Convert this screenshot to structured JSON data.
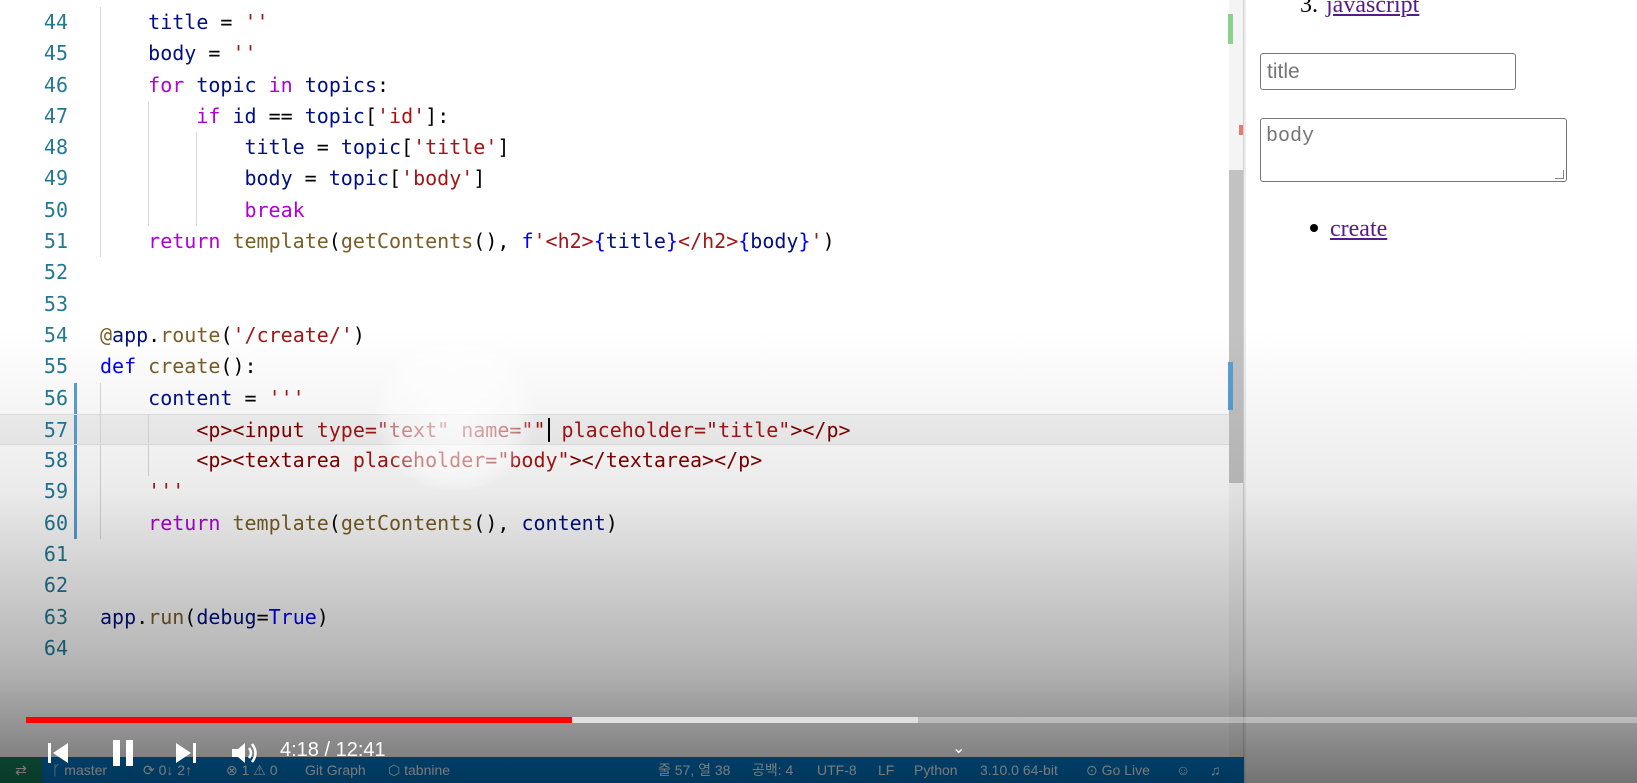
{
  "editor": {
    "lines": [
      {
        "n": "44",
        "indent": 1,
        "tokens": [
          [
            "id",
            "title"
          ],
          [
            "pun",
            " = "
          ],
          [
            "st",
            "''"
          ]
        ]
      },
      {
        "n": "45",
        "indent": 1,
        "tokens": [
          [
            "id",
            "body"
          ],
          [
            "pun",
            " = "
          ],
          [
            "st",
            "''"
          ]
        ]
      },
      {
        "n": "46",
        "indent": 1,
        "tokens": [
          [
            "kw",
            "for"
          ],
          [
            "pun",
            " "
          ],
          [
            "id",
            "topic"
          ],
          [
            "pun",
            " "
          ],
          [
            "kw",
            "in"
          ],
          [
            "pun",
            " "
          ],
          [
            "id",
            "topics"
          ],
          [
            "pun",
            ":"
          ]
        ]
      },
      {
        "n": "47",
        "indent": 2,
        "tokens": [
          [
            "kw",
            "if"
          ],
          [
            "pun",
            " "
          ],
          [
            "id",
            "id"
          ],
          [
            "pun",
            " == "
          ],
          [
            "id",
            "topic"
          ],
          [
            "pun",
            "["
          ],
          [
            "st",
            "'id'"
          ],
          [
            "pun",
            "]:"
          ]
        ]
      },
      {
        "n": "48",
        "indent": 3,
        "tokens": [
          [
            "id",
            "title"
          ],
          [
            "pun",
            " = "
          ],
          [
            "id",
            "topic"
          ],
          [
            "pun",
            "["
          ],
          [
            "st",
            "'title'"
          ],
          [
            "pun",
            "]"
          ]
        ]
      },
      {
        "n": "49",
        "indent": 3,
        "tokens": [
          [
            "id",
            "body"
          ],
          [
            "pun",
            " = "
          ],
          [
            "id",
            "topic"
          ],
          [
            "pun",
            "["
          ],
          [
            "st",
            "'body'"
          ],
          [
            "pun",
            "]"
          ]
        ]
      },
      {
        "n": "50",
        "indent": 3,
        "tokens": [
          [
            "kw",
            "break"
          ]
        ]
      },
      {
        "n": "51",
        "indent": 1,
        "tokens": [
          [
            "kw",
            "return"
          ],
          [
            "pun",
            " "
          ],
          [
            "fn",
            "template"
          ],
          [
            "pun",
            "("
          ],
          [
            "fn",
            "getContents"
          ],
          [
            "pun",
            "(), "
          ],
          [
            "kd",
            "f"
          ],
          [
            "st",
            "'<h2>"
          ],
          [
            "kd",
            "{"
          ],
          [
            "id",
            "title"
          ],
          [
            "kd",
            "}"
          ],
          [
            "st",
            "</h2>"
          ],
          [
            "kd",
            "{"
          ],
          [
            "id",
            "body"
          ],
          [
            "kd",
            "}"
          ],
          [
            "st",
            "'"
          ],
          [
            "pun",
            ")"
          ]
        ]
      },
      {
        "n": "52",
        "indent": 0,
        "tokens": []
      },
      {
        "n": "53",
        "indent": 0,
        "tokens": []
      },
      {
        "n": "54",
        "indent": 0,
        "tokens": [
          [
            "de",
            "@"
          ],
          [
            "id",
            "app"
          ],
          [
            "pun",
            "."
          ],
          [
            "fn",
            "route"
          ],
          [
            "pun",
            "("
          ],
          [
            "st",
            "'/create/'"
          ],
          [
            "pun",
            ")"
          ]
        ]
      },
      {
        "n": "55",
        "indent": 0,
        "tokens": [
          [
            "kd",
            "def"
          ],
          [
            "pun",
            " "
          ],
          [
            "fn",
            "create"
          ],
          [
            "pun",
            "():"
          ]
        ]
      },
      {
        "n": "56",
        "indent": 1,
        "tokens": [
          [
            "id",
            "content"
          ],
          [
            "pun",
            " = "
          ],
          [
            "st",
            "'''"
          ]
        ]
      },
      {
        "n": "57",
        "indent": 2,
        "cursor_after": 9,
        "tokens": [
          [
            "tag",
            "<p><input"
          ],
          [
            "st",
            " type=\"text\" name=\"\""
          ],
          [
            "st",
            " placeholder=\"title\""
          ],
          [
            "tag",
            "></p>"
          ]
        ]
      },
      {
        "n": "58",
        "indent": 2,
        "tokens": [
          [
            "tag",
            "<p><textarea"
          ],
          [
            "st",
            " placeholder=\"body\""
          ],
          [
            "tag",
            "></textarea></p>"
          ]
        ]
      },
      {
        "n": "59",
        "indent": 1,
        "tokens": [
          [
            "st",
            "'''"
          ]
        ]
      },
      {
        "n": "60",
        "indent": 1,
        "tokens": [
          [
            "kw",
            "return"
          ],
          [
            "pun",
            " "
          ],
          [
            "fn",
            "template"
          ],
          [
            "pun",
            "("
          ],
          [
            "fn",
            "getContents"
          ],
          [
            "pun",
            "(), "
          ],
          [
            "id",
            "content"
          ],
          [
            "pun",
            ")"
          ]
        ]
      },
      {
        "n": "61",
        "indent": 0,
        "tokens": []
      },
      {
        "n": "62",
        "indent": 0,
        "tokens": []
      },
      {
        "n": "63",
        "indent": 0,
        "tokens": [
          [
            "id",
            "app"
          ],
          [
            "pun",
            "."
          ],
          [
            "fn",
            "run"
          ],
          [
            "pun",
            "("
          ],
          [
            "id",
            "debug"
          ],
          [
            "pun",
            "="
          ],
          [
            "kd",
            "True"
          ],
          [
            "pun",
            ")"
          ]
        ]
      },
      {
        "n": "64",
        "indent": 0,
        "tokens": []
      }
    ]
  },
  "preview": {
    "list_number": "3.",
    "list_link": "javascript",
    "title_placeholder": "title",
    "body_placeholder": "body",
    "create_link": "create"
  },
  "statusbar": {
    "remote_icon": "remote-icon",
    "branch": "master",
    "sync": "0↓ 2↑",
    "problems": "⊗ 1 ⚠ 0",
    "git_graph": "Git Graph",
    "tabnine": "tabnine",
    "cursor_position": "줄 57, 열 38",
    "indent": "공백: 4",
    "encoding": "UTF-8",
    "eol": "LF",
    "language": "Python",
    "interpreter": "3.10.0 64-bit",
    "go_live": "Go Live"
  },
  "video": {
    "time": "4:18 / 12:41",
    "played_fraction": 0.339,
    "buffered_fraction": 0.554
  },
  "colors": {
    "statusbar_bg": "#007acc",
    "remote_bg": "#16825d",
    "progress_played": "#ff0000",
    "link_visited": "#551a8b"
  }
}
